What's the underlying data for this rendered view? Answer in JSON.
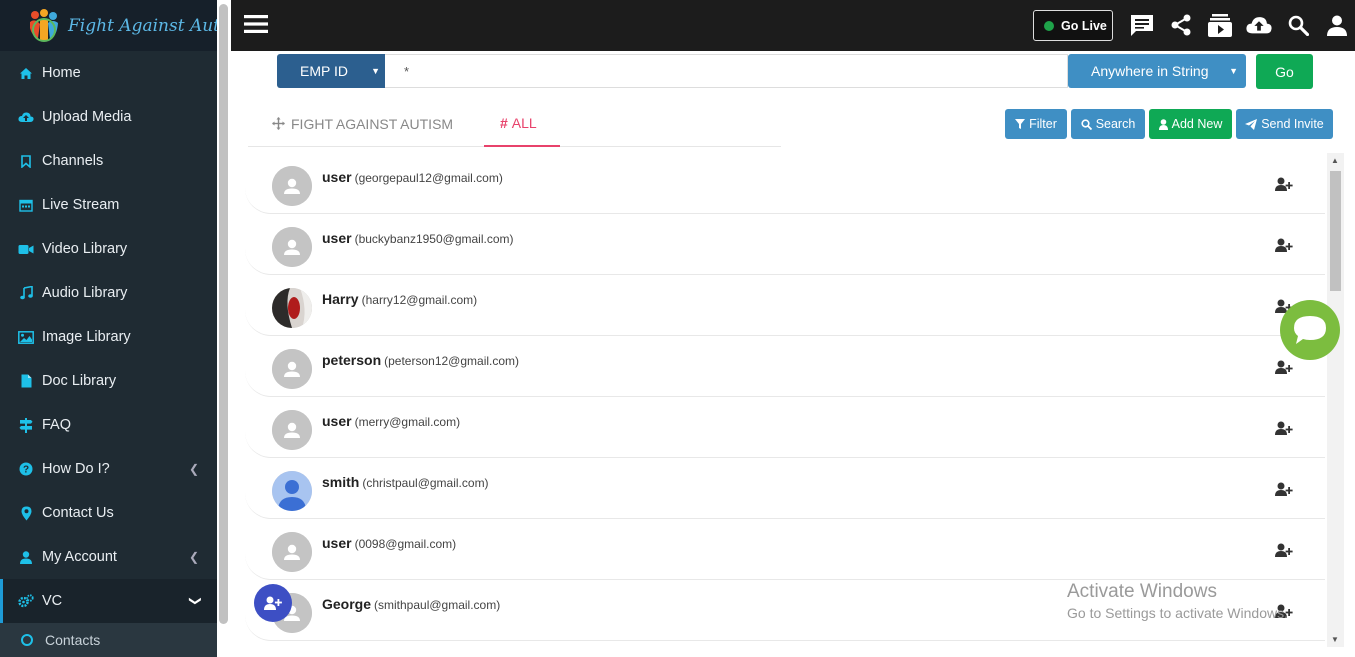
{
  "brand": {
    "name": "Fight Against Autism"
  },
  "sidebar": {
    "items": [
      {
        "label": "Home",
        "icon": "home-icon"
      },
      {
        "label": "Upload Media",
        "icon": "cloud-upload-icon"
      },
      {
        "label": "Channels",
        "icon": "bookmark-icon"
      },
      {
        "label": "Live Stream",
        "icon": "calendar-icon"
      },
      {
        "label": "Video Library",
        "icon": "video-camera-icon"
      },
      {
        "label": "Audio Library",
        "icon": "music-note-icon"
      },
      {
        "label": "Image Library",
        "icon": "image-icon"
      },
      {
        "label": "Doc Library",
        "icon": "document-icon"
      },
      {
        "label": "FAQ",
        "icon": "signpost-icon"
      },
      {
        "label": "How Do I?",
        "icon": "question-circle-icon"
      },
      {
        "label": "Contact Us",
        "icon": "map-pin-icon"
      },
      {
        "label": "My Account",
        "icon": "user-icon"
      },
      {
        "label": "VC",
        "icon": "cogs-icon"
      }
    ],
    "sub_items": [
      {
        "label": "Contacts"
      }
    ]
  },
  "topbar": {
    "golive_label": "Go Live"
  },
  "search": {
    "field_select": "EMP ID",
    "query_value": "*",
    "match_mode": "Anywhere in String",
    "go_label": "Go"
  },
  "tabs": [
    {
      "label": "FIGHT AGAINST AUTISM"
    },
    {
      "label": "ALL"
    }
  ],
  "actions": {
    "filter": "Filter",
    "search": "Search",
    "add_new": "Add New",
    "send_invite": "Send Invite"
  },
  "contacts": [
    {
      "name": "user",
      "email": "(georgepaul12@gmail.com)"
    },
    {
      "name": "user",
      "email": "(buckybanz1950@gmail.com)"
    },
    {
      "name": "Harry",
      "email": "(harry12@gmail.com)"
    },
    {
      "name": "peterson",
      "email": "(peterson12@gmail.com)"
    },
    {
      "name": "user",
      "email": "(merry@gmail.com)"
    },
    {
      "name": "smith",
      "email": "(christpaul@gmail.com)"
    },
    {
      "name": "user",
      "email": "(0098@gmail.com)"
    },
    {
      "name": "George",
      "email": "(smithpaul@gmail.com)"
    }
  ],
  "watermark": {
    "line1": "Activate Windows",
    "line2": "Go to Settings to activate Windows."
  },
  "colors": {
    "sidebar_bg": "#1f2b33",
    "accent_blue": "#1e9bd7",
    "tab_active": "#e8426b",
    "go_green": "#0fa955",
    "chat_green": "#7cbd3f"
  }
}
